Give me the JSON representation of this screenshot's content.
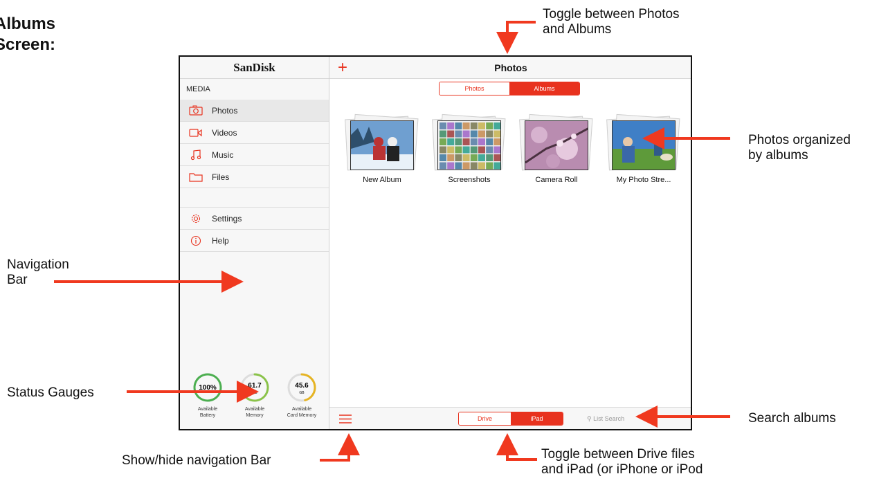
{
  "annotations": {
    "title": "Albums\nScreen:",
    "toggle_photos_albums": "Toggle between Photos\nand Albums",
    "photos_by_albums": "Photos organized\nby albums",
    "navigation_bar": "Navigation\nBar",
    "status_gauges": "Status Gauges",
    "search_albums": "Search albums",
    "show_hide_nav": "Show/hide navigation Bar",
    "toggle_drive_ipad": "Toggle between Drive files\nand iPad (or iPhone or iPod"
  },
  "sidebar": {
    "logo": "SanDisk",
    "section": "MEDIA",
    "items": [
      {
        "label": "Photos",
        "icon": "camera-icon",
        "active": true
      },
      {
        "label": "Videos",
        "icon": "video-icon",
        "active": false
      },
      {
        "label": "Music",
        "icon": "music-icon",
        "active": false
      },
      {
        "label": "Files",
        "icon": "folder-icon",
        "active": false
      }
    ],
    "extra": [
      {
        "label": "Settings",
        "icon": "gear-icon"
      },
      {
        "label": "Help",
        "icon": "info-icon"
      }
    ],
    "gauges": [
      {
        "value": "100%",
        "unit": "",
        "fraction": 1.0,
        "label": "Available\nBattery"
      },
      {
        "value": "61.7",
        "unit": "GB",
        "fraction": 0.62,
        "label": "Available\nMemory"
      },
      {
        "value": "45.6",
        "unit": "GB",
        "fraction": 0.46,
        "label": "Available\nCard Memory"
      }
    ]
  },
  "main": {
    "title": "Photos",
    "add_label": "+",
    "view_toggle": {
      "photos": "Photos",
      "albums": "Albums",
      "selected": "Albums"
    },
    "albums": [
      {
        "name": "New Album",
        "thumb": "winter-couple-photo"
      },
      {
        "name": "Screenshots",
        "thumb": "screenshot-grid"
      },
      {
        "name": "Camera Roll",
        "thumb": "cherry-blossom-photo"
      },
      {
        "name": "My Photo Stre...",
        "thumb": "dog-park-photo"
      }
    ],
    "source_toggle": {
      "drive": "Drive",
      "ipad": "iPad",
      "selected": "iPad"
    },
    "search_placeholder": "List Search"
  },
  "colors": {
    "accent": "#e8321e",
    "arrow": "#f0391f"
  }
}
